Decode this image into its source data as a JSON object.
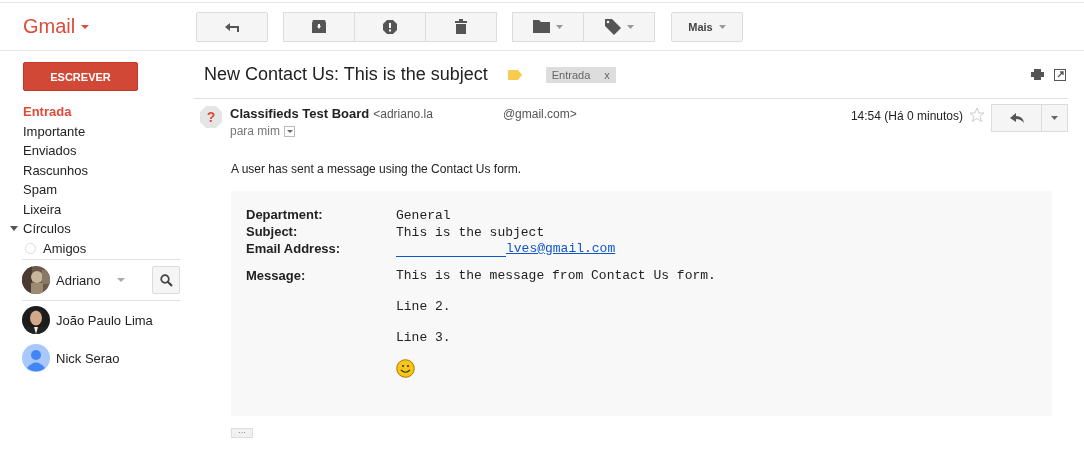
{
  "app": {
    "logo": "Gmail"
  },
  "toolbar": {
    "more_label": "Mais"
  },
  "sidebar": {
    "compose": "ESCREVER",
    "items": [
      {
        "label": "Entrada",
        "selected": true
      },
      {
        "label": "Importante",
        "selected": false
      },
      {
        "label": "Enviados",
        "selected": false
      },
      {
        "label": "Rascunhos",
        "selected": false
      },
      {
        "label": "Spam",
        "selected": false
      },
      {
        "label": "Lixeira",
        "selected": false
      },
      {
        "label": "Círculos",
        "selected": false,
        "kind": "group",
        "expanded": true,
        "children": [
          {
            "label": "Amigos",
            "selected": false
          }
        ]
      }
    ]
  },
  "chat": {
    "me": {
      "name": "Adriano",
      "kind": "picture"
    },
    "contacts": [
      {
        "name": "João Paulo Lima",
        "kind": "picture"
      },
      {
        "name": "Nick Serao",
        "kind": "placeholder"
      }
    ]
  },
  "message": {
    "subject": "New Contact Us: This is the subject",
    "labels": [
      "Entrada"
    ],
    "label_remove": "x",
    "sender_avatar": "?",
    "sender_name": "Classifieds Test Board",
    "sender_email_start": "<adriano.la",
    "sender_email_end": "@gmail.com>",
    "recipient": "para mim",
    "time": "14:54 (Há 0 minutos)",
    "starred": false,
    "intro": "A user has sent a message using the Contact Us form.",
    "fields": [
      {
        "label": "Department:",
        "value": "General",
        "kind": "text"
      },
      {
        "label": "Subject:",
        "value": "This is the subject",
        "kind": "text"
      },
      {
        "label": "Email Address:",
        "value": "lves@gmail.com",
        "kind": "link"
      },
      {
        "label": "Message:",
        "kind": "message",
        "lines": [
          "This is the message from Contact Us form.",
          "Line 2.",
          "Line 3."
        ]
      }
    ],
    "trimmed_button": "···"
  }
}
